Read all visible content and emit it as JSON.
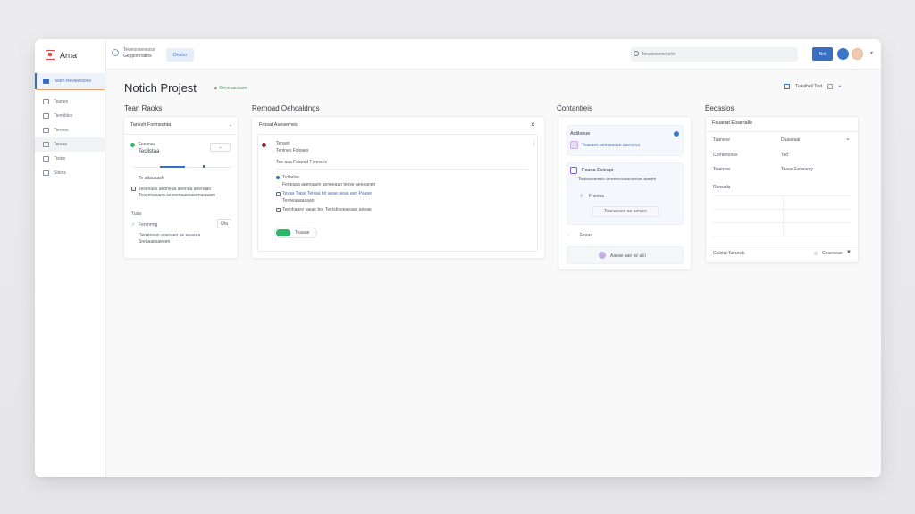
{
  "app": {
    "name": "Arna"
  },
  "sidebar": {
    "items": [
      {
        "label": "Tearn Reviewsions"
      },
      {
        "label": "Teanes"
      },
      {
        "label": "Tiemibles"
      },
      {
        "label": "Tiernes"
      },
      {
        "label": "Tereas"
      },
      {
        "label": "Tistes"
      },
      {
        "label": "Sitens"
      }
    ]
  },
  "topbar": {
    "crumb_top": "Tewesosenesss",
    "crumb_main": "Gepporeratins",
    "chip": "Dnebo",
    "search_placeholder": "Tesoonsenenelor",
    "primary_label": "Net"
  },
  "page": {
    "title": "Notich Projest",
    "tag": "Genmaesiase",
    "action_label": "Tukalheil Tost"
  },
  "columns": {
    "tasks": {
      "title": "Tean Raoks",
      "card_header": "Tanksh Formsonta",
      "item1_title": "Feesnaa",
      "item1_sub": "Tecilstaa",
      "item1_btn": "",
      "item1_note": "Te adauaach",
      "item1_desc1": "Tesenaas aeoneaa aeenaa aeenaan",
      "item1_desc2": "Teseenasaen aeseenaaesaeenaaaaen",
      "section_label": "Tusa",
      "item2_title": "Fersnrmg",
      "item2_btn": "Ota",
      "item2_desc1": "Derrenaan aoesaen ae aeaaaa",
      "item2_desc2": "Srenaaesaeeen"
    },
    "rental": {
      "title": "Rernoad Oehcaldngs",
      "card_header": "Frosat Asesernes",
      "user_name": "Tenast",
      "user_sub": "Tenlnes Foloaes",
      "row1": "Tee aaa Fstared Fennaee",
      "row2_title": "Tvtbalse",
      "row2_desc": "Feneaaa aeenaaen aeneeaan teese aeeaanen",
      "row3": "Tevaa Tiase Teisaa tet aeae aeaa aen Paaae",
      "row3_sub": "Teseeaaaaaaan",
      "row4": "Teenhaasy taeae bor Tenlsbseeaeaae aneae",
      "toggle_label": "Teaaae"
    },
    "contents": {
      "title": "Contantieis",
      "tile1_title": "Actilsoue",
      "tile1_desc": "Teasaes aeesesaae aaeeesa",
      "tile2_title": "Foana Esieapi",
      "tile2_desc": "Teaaseaeees aeeeeesaaeseese aaeee",
      "tile2_item": "Fnenna",
      "tile2_btn": "Toanaosen ae aetaee",
      "row_label": "Feaas",
      "footer_btn": "Aaeae aae ta! aEl"
    },
    "details": {
      "title": "Eecasios",
      "card_header": "Fsuanat Eisamalle",
      "rows": [
        {
          "k": "Taanese",
          "v": "Duaaeaal"
        },
        {
          "k": "Corrantonas",
          "v": "Teo"
        },
        {
          "k": "Teaenne",
          "v": "Teaae Eeseanty"
        }
      ],
      "section": "Rensaila",
      "footer_left": "Calotal Taraesls",
      "footer_right": "Ceaeseae"
    }
  },
  "colors": {
    "accent": "#3a6ec0",
    "brand": "#e0483e",
    "success": "#2db56a",
    "purple": "#8a5bd0"
  }
}
